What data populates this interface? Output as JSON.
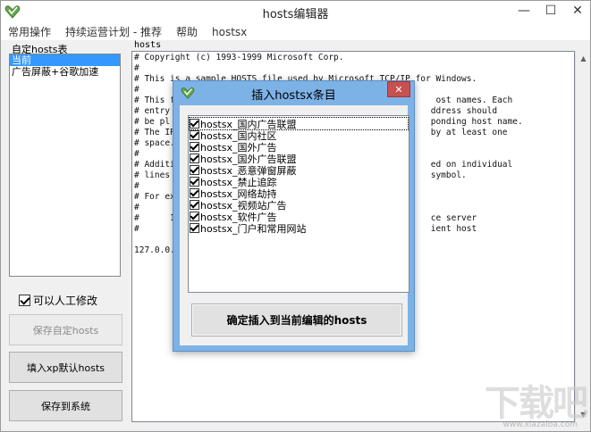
{
  "window": {
    "title": "hosts编辑器",
    "controls": {
      "minimize": "—",
      "maximize": "☐",
      "close": "✕"
    }
  },
  "menubar": [
    "常用操作",
    "持续运营计划 - 推荐",
    "帮助",
    "hostsx"
  ],
  "left_panel": {
    "label": "自定hosts表",
    "items": [
      {
        "label": "当前",
        "selected": true
      },
      {
        "label": "广告屏蔽+谷歌加速",
        "selected": false
      }
    ],
    "manual_edit": {
      "label": "可以人工修改",
      "checked": true
    },
    "buttons": {
      "save_custom": "保存自定hosts",
      "fill_xp_default": "填入xp默认hosts",
      "save_to_system": "保存到系统"
    }
  },
  "editor": {
    "label": "hosts",
    "content": "# Copyright (c) 1993-1999 Microsoft Corp.\n#\n# This is a sample HOSTS file used by Microsoft TCP/IP for Windows.\n#\n# This f                                                   ost names. Each\n# entry                                                   ddress should\n# be pl                                                   ponding host name.\n# The IP                                                  by at least one\n# space.\n#\n# Additi                                                  ed on individual\n# lines                                                   symbol.\n#\n# For ex\n#\n#      1                                                  ce server\n#                                                         ient host\n\n127.0.0.1"
  },
  "dialog": {
    "title": "插入hostsx条目",
    "close": "✕",
    "items": [
      {
        "label": "hostsx_国内广告联盟",
        "checked": true
      },
      {
        "label": "hostsx_国内社区",
        "checked": true
      },
      {
        "label": "hostsx_国外广告",
        "checked": true
      },
      {
        "label": "hostsx_国外广告联盟",
        "checked": true
      },
      {
        "label": "hostsx_恶意弹窗屏蔽",
        "checked": true
      },
      {
        "label": "hostsx_禁止追踪",
        "checked": true
      },
      {
        "label": "hostsx_网络劫持",
        "checked": true
      },
      {
        "label": "hostsx_视频站广告",
        "checked": true
      },
      {
        "label": "hostsx_软件广告",
        "checked": true
      },
      {
        "label": "hostsx_门户和常用网站",
        "checked": true
      }
    ],
    "confirm_button": "确定插入到当前编辑的hosts"
  },
  "watermark": {
    "text": "下载吧",
    "url": "www.xiazaiba.com"
  },
  "colors": {
    "selection": "#3399ff",
    "dialog_frame": "#7db2e7",
    "close_red": "#c75050",
    "icon_green": "#6aa84f"
  }
}
